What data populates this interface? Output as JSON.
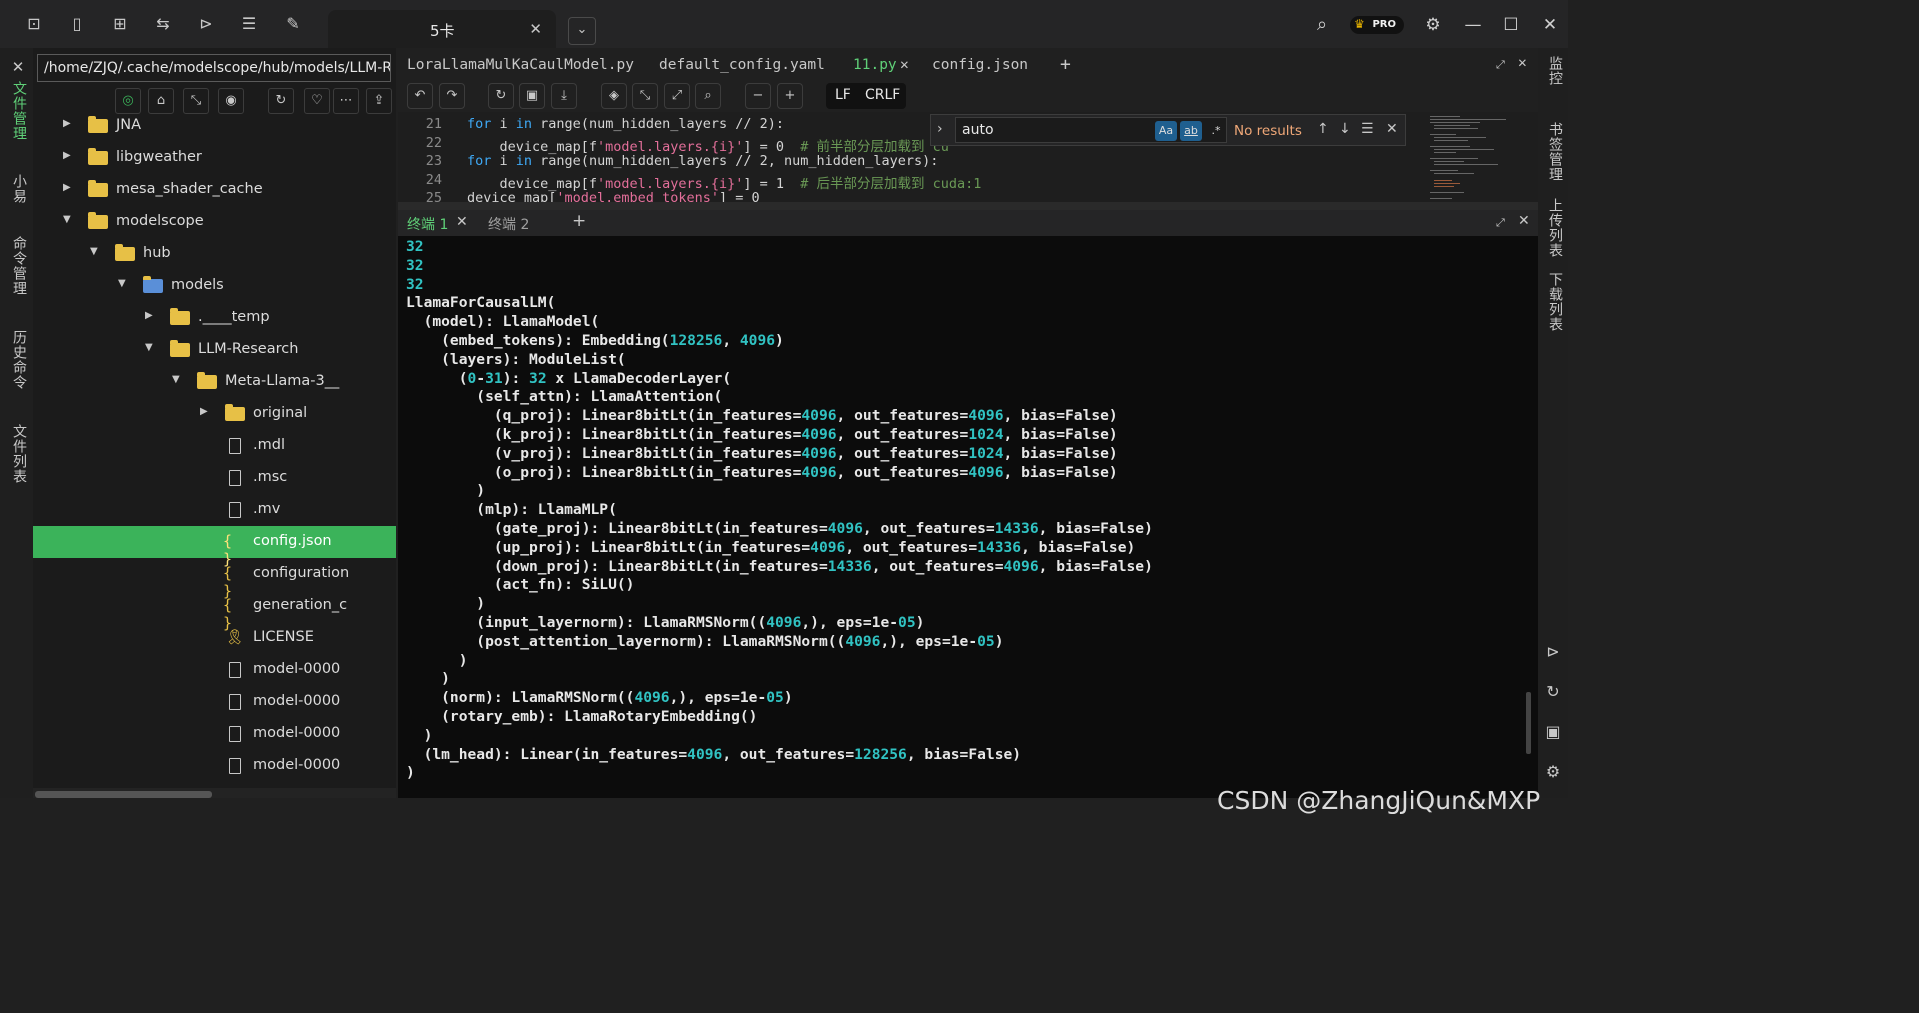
{
  "window": {
    "tab_title": "5卡",
    "tab_close": "✕",
    "tab_dropdown": "⌄",
    "pro_badge": "PRO",
    "icons": [
      "search-icon",
      "crown-pro-icon",
      "gear-icon",
      "minimize-icon",
      "maximize-icon",
      "close-icon"
    ]
  },
  "left_sidebar": {
    "items": [
      "文件管理",
      "小易",
      "命令管理",
      "历史命令",
      "文件列表"
    ],
    "close": "✕"
  },
  "file_tree": {
    "path": "/home/ZJQ/.cache/modelscope/hub/models/LLM-R",
    "items": [
      {
        "name": "JNA",
        "type": "folder",
        "expanded": false
      },
      {
        "name": "libgweather",
        "type": "folder",
        "expanded": false
      },
      {
        "name": "mesa_shader_cache",
        "type": "folder",
        "expanded": false
      },
      {
        "name": "modelscope",
        "type": "folder",
        "expanded": true
      },
      {
        "name": "hub",
        "type": "folder",
        "expanded": true
      },
      {
        "name": "models",
        "type": "shared-folder",
        "expanded": true
      },
      {
        "name": ".____temp",
        "type": "folder",
        "expanded": false
      },
      {
        "name": "LLM-Research",
        "type": "folder",
        "expanded": true
      },
      {
        "name": "Meta-Llama-3__",
        "type": "folder",
        "expanded": true
      },
      {
        "name": "original",
        "type": "folder",
        "expanded": false
      },
      {
        "name": ".mdl",
        "type": "file"
      },
      {
        "name": ".msc",
        "type": "file"
      },
      {
        "name": ".mv",
        "type": "file"
      },
      {
        "name": "config.json",
        "type": "json",
        "selected": true
      },
      {
        "name": "configuration",
        "type": "json"
      },
      {
        "name": "generation_c",
        "type": "json"
      },
      {
        "name": "LICENSE",
        "type": "license"
      },
      {
        "name": "model-0000",
        "type": "file"
      },
      {
        "name": "model-0000",
        "type": "file"
      },
      {
        "name": "model-0000",
        "type": "file"
      },
      {
        "name": "model-0000",
        "type": "file"
      }
    ]
  },
  "editor": {
    "tabs": [
      {
        "label": "LoraLlamaMulKaCaulModel.py",
        "active": false
      },
      {
        "label": "default_config.yaml",
        "active": false
      },
      {
        "label": "11.py",
        "active": true
      },
      {
        "label": "config.json",
        "active": false
      }
    ],
    "add_tab": "+",
    "tab_close": "✕",
    "eol": {
      "lf": "LF",
      "crlf": "CRLF"
    },
    "code_lines": [
      {
        "num": "21",
        "kw": "for",
        "text1": " i ",
        "kw2": "in",
        "text2": " range(num_hidden_layers // 2):"
      },
      {
        "num": "22",
        "pre": "    device_map[f",
        "str": "'model.layers.{i}'",
        "post": "] = 0  ",
        "cm": "# 前半部分层加载到 cu"
      },
      {
        "num": "23",
        "kw": "for",
        "text1": " i ",
        "kw2": "in",
        "text2": " range(num_hidden_layers // 2, num_hidden_layers):"
      },
      {
        "num": "24",
        "pre": "    device_map[f",
        "str": "'model.layers.{i}'",
        "post": "] = 1  ",
        "cm": "# 后半部分层加载到 cuda:1"
      },
      {
        "num": "25",
        "pre": "device_map[",
        "str": "'model.embed_tokens'",
        "post": "] = 0",
        "cm": ""
      }
    ],
    "find": {
      "value": "auto",
      "match_case": "Aa",
      "whole_word": "ab",
      "regex": ".*",
      "status": "No results"
    }
  },
  "terminal": {
    "tabs": [
      {
        "label": "终端 1",
        "active": true
      },
      {
        "label": "终端 2",
        "active": false
      }
    ],
    "add_tab": "+",
    "tab_close": "✕",
    "lines": [
      "32",
      "32",
      "32",
      "LlamaForCausalLM(",
      "  (model): LlamaModel(",
      "    (embed_tokens): Embedding(128256, 4096)",
      "    (layers): ModuleList(",
      "      (0-31): 32 x LlamaDecoderLayer(",
      "        (self_attn): LlamaAttention(",
      "          (q_proj): Linear8bitLt(in_features=4096, out_features=4096, bias=False)",
      "          (k_proj): Linear8bitLt(in_features=4096, out_features=1024, bias=False)",
      "          (v_proj): Linear8bitLt(in_features=4096, out_features=1024, bias=False)",
      "          (o_proj): Linear8bitLt(in_features=4096, out_features=4096, bias=False)",
      "        )",
      "        (mlp): LlamaMLP(",
      "          (gate_proj): Linear8bitLt(in_features=4096, out_features=14336, bias=False)",
      "          (up_proj): Linear8bitLt(in_features=4096, out_features=14336, bias=False)",
      "          (down_proj): Linear8bitLt(in_features=14336, out_features=4096, bias=False)",
      "          (act_fn): SiLU()",
      "        )",
      "        (input_layernorm): LlamaRMSNorm((4096,), eps=1e-05)",
      "        (post_attention_layernorm): LlamaRMSNorm((4096,), eps=1e-05)",
      "      )",
      "    )",
      "    (norm): LlamaRMSNorm((4096,), eps=1e-05)",
      "    (rotary_emb): LlamaRotaryEmbedding()",
      "  )",
      "  (lm_head): Linear(in_features=4096, out_features=128256, bias=False)",
      ")"
    ]
  },
  "right_sidebar": {
    "items": [
      "监控",
      "书签管理",
      "上传列表",
      "下载列表"
    ]
  },
  "watermark": "CSDN @ZhangJiQun&MXP",
  "colors": {
    "accent": "#3bb35a",
    "tab_active_text": "#5fd078",
    "number": "#31c3c3",
    "keyword": "#3fa9f5",
    "string": "#e36f9a",
    "comment": "#6a9955",
    "no_results": "#f0a878"
  }
}
